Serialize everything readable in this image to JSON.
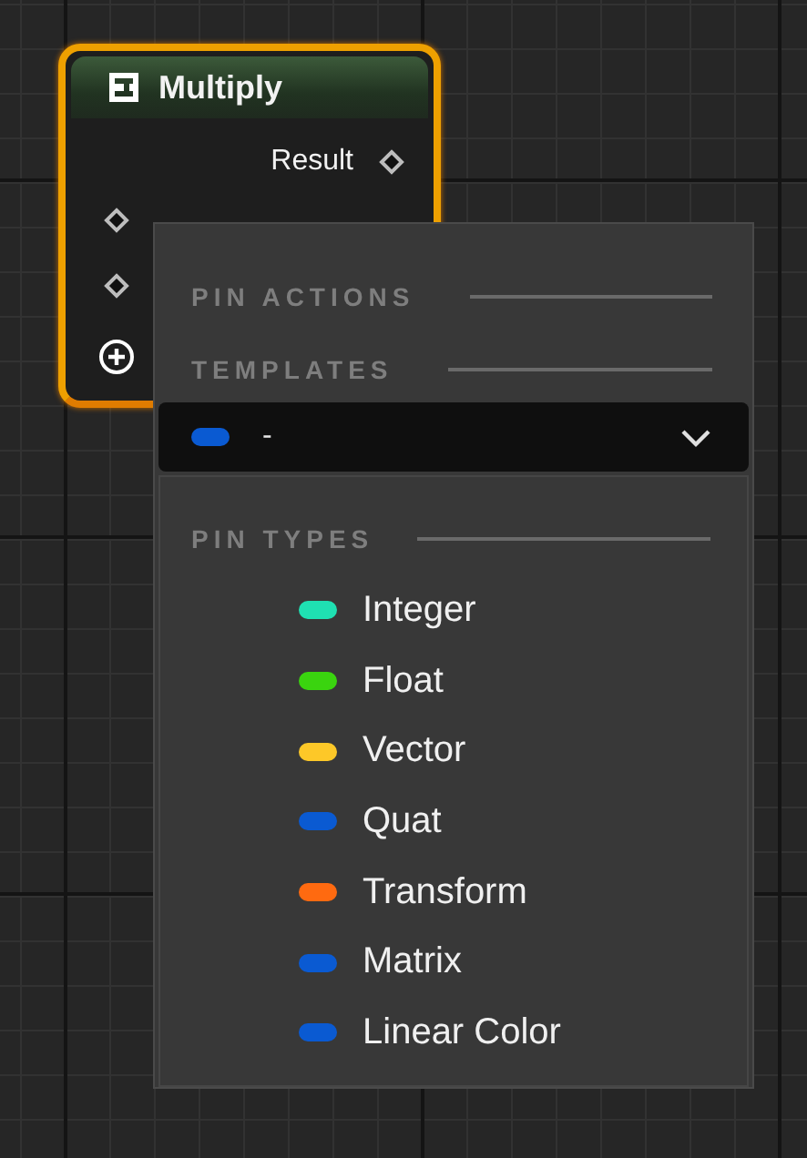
{
  "node": {
    "title": "Multiply",
    "selected": true,
    "outputs": [
      {
        "label": "Result"
      }
    ],
    "input_pins": [
      {
        "kind": "pin"
      },
      {
        "kind": "pin"
      },
      {
        "kind": "add"
      }
    ]
  },
  "menu": {
    "sections": [
      {
        "title": "PIN ACTIONS"
      },
      {
        "title": "TEMPLATES"
      }
    ],
    "dropdown": {
      "value": "-",
      "color": "#0a5ad2"
    },
    "pin_types": {
      "title": "PIN TYPES",
      "items": [
        {
          "label": "Integer",
          "color": "#1fe0b2"
        },
        {
          "label": "Float",
          "color": "#3ad40f"
        },
        {
          "label": "Vector",
          "color": "#fdc828"
        },
        {
          "label": "Quat",
          "color": "#0a5ad2"
        },
        {
          "label": "Transform",
          "color": "#ff6a10"
        },
        {
          "label": "Matrix",
          "color": "#0a5ad2"
        },
        {
          "label": "Linear Color",
          "color": "#0a5ad2"
        }
      ]
    }
  }
}
